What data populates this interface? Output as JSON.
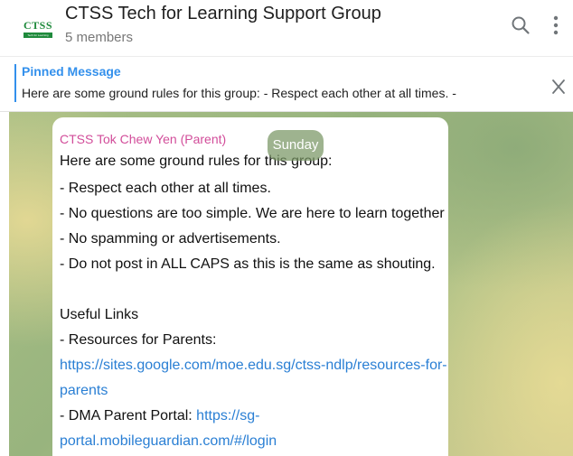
{
  "header": {
    "logo_text": "CTSS",
    "logo_sub": "Tech for Learning",
    "title": "CTSS Tech for Learning Support Group",
    "subtitle": "5 members"
  },
  "pinned": {
    "title": "Pinned Message",
    "text": "Here are some ground rules for this group: - Respect each other at all times. -"
  },
  "chat": {
    "date_label": "Sunday",
    "message": {
      "sender": "CTSS Tok Chew Yen (Parent)",
      "sender_color": "#d24d9a",
      "lines": {
        "l0": "Here are some ground rules for this group:",
        "l1": "- Respect each other at all times.",
        "l2": "- No questions are too simple. We are here to learn together",
        "l3": "- No spamming or advertisements.",
        "l4": "- Do not post in ALL CAPS as this is the same as shouting.",
        "l5": "Useful Links",
        "l6": "- Resources for Parents:",
        "l7": "https://sites.google.com/moe.edu.sg/ctss-ndlp/resources-for-",
        "l8": "parents",
        "l9_prefix": "- DMA Parent Portal: ",
        "l9_link": "https://sg-",
        "l10": "portal.mobileguardian.com/#/login"
      }
    }
  },
  "icons": {
    "search": "search-icon",
    "more": "more-vertical-icon",
    "close": "close-icon"
  },
  "colors": {
    "accent": "#3390ec",
    "link": "#2a7fd4",
    "logo_green": "#1f8a3c"
  }
}
